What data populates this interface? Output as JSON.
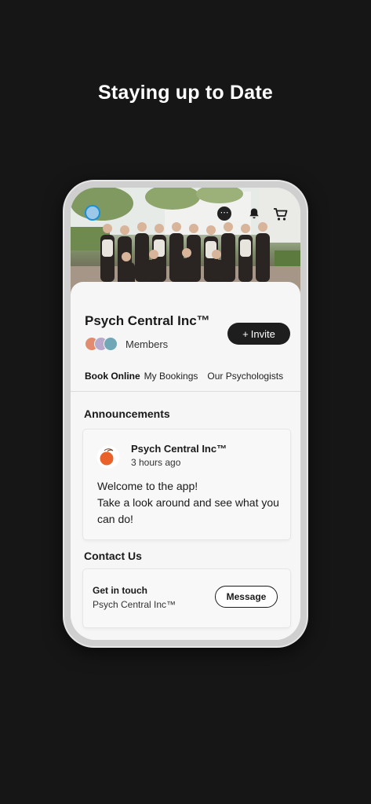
{
  "headline": "Staying up to Date",
  "header": {
    "more_label": "⋯"
  },
  "group": {
    "name": "Psych Central Inc™",
    "invite_label": "Invite",
    "invite_plus": "+",
    "members_label": "Members"
  },
  "tabs": [
    "Book Online",
    "My Bookings",
    "Our Psychologists"
  ],
  "announcements": {
    "title": "Announcements",
    "post": {
      "author": "Psych Central Inc™",
      "time": "3 hours ago",
      "line1": "Welcome to the app!",
      "line2": "Take a look around and see what you can do!"
    }
  },
  "contact": {
    "title": "Contact Us",
    "card_title": "Get in touch",
    "card_sub": "Psych Central Inc™",
    "message_label": "Message"
  },
  "colors": {
    "background": "#161616",
    "button_dark": "#1e1e1e",
    "logo_orange": "#e8622a"
  }
}
